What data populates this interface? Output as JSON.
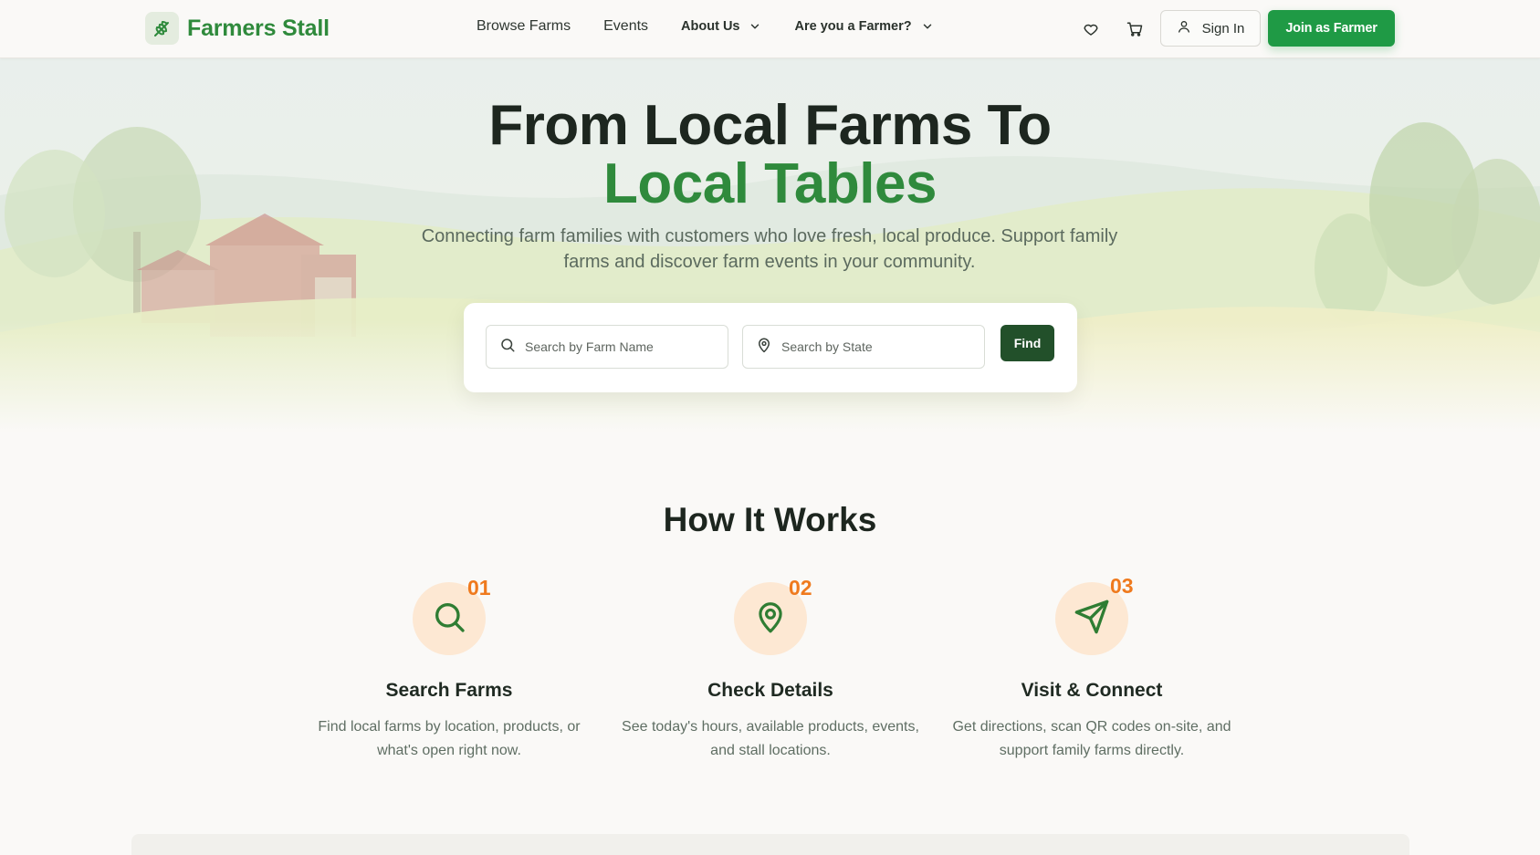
{
  "brand": {
    "name": "Farmers Stall",
    "icon": "wheat-icon",
    "color": "#2f8a3c"
  },
  "nav": {
    "browse": "Browse Farms",
    "events": "Events",
    "about": "About Us",
    "farmer": "Are you a Farmer?"
  },
  "header_actions": {
    "favorites_icon": "heart-icon",
    "cart_icon": "cart-icon",
    "signin": "Sign In",
    "join": "Join as Farmer"
  },
  "hero": {
    "title_line1": "From Local Farms To",
    "title_line2": "Local Tables",
    "subtitle": "Connecting farm families with customers who love fresh, local produce. Support family farms and discover farm events in your community."
  },
  "search": {
    "farm_placeholder": "Search by Farm Name",
    "state_placeholder": "Search by State",
    "find": "Find"
  },
  "how": {
    "title": "How It Works",
    "steps": [
      {
        "num": "01",
        "icon": "search-icon",
        "title": "Search Farms",
        "desc": "Find local farms by location, products, or what's open right now."
      },
      {
        "num": "02",
        "icon": "map-pin-icon",
        "title": "Check Details",
        "desc": "See today's hours, available products, events, and stall locations."
      },
      {
        "num": "03",
        "icon": "send-icon",
        "title": "Visit & Connect",
        "desc": "Get directions, scan QR codes on-site, and support family farms directly."
      }
    ]
  },
  "colors": {
    "accent": "#2f8a3c",
    "primary_button": "#1f9a45",
    "dark_button": "#22502a",
    "step_number": "#ef7a1e",
    "step_circle": "#fde8d3"
  }
}
